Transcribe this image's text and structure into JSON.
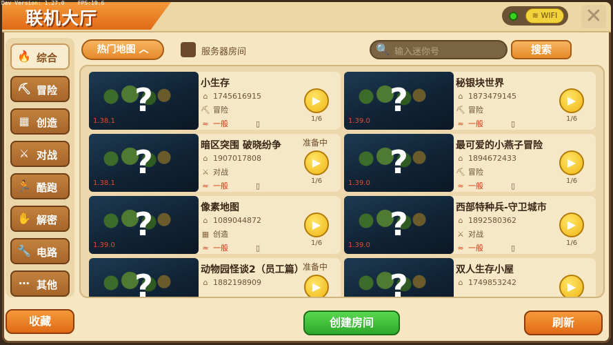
{
  "debug": {
    "version": "Dev Version: 1.27.0",
    "fps": "FPS:19.6"
  },
  "header": {
    "title": "联机大厅",
    "wifi_label": "WIFI",
    "close_symbol": "✕"
  },
  "sidebar": {
    "items": [
      {
        "label": "综合",
        "icon": "flame-icon",
        "glyph": "🔥",
        "active": true
      },
      {
        "label": "冒险",
        "icon": "pickaxe-icon",
        "glyph": "⛏"
      },
      {
        "label": "创造",
        "icon": "blocks-icon",
        "glyph": "▦"
      },
      {
        "label": "对战",
        "icon": "swords-icon",
        "glyph": "⚔"
      },
      {
        "label": "酷跑",
        "icon": "runner-icon",
        "glyph": "🏃"
      },
      {
        "label": "解密",
        "icon": "puzzle-icon",
        "glyph": "✋"
      },
      {
        "label": "电路",
        "icon": "wrench-icon",
        "glyph": "🔧"
      },
      {
        "label": "其他",
        "icon": "more-icon",
        "glyph": "⋯"
      }
    ]
  },
  "filters": {
    "hot_map_label": "热门地图",
    "hot_map_arrow": "︿",
    "server_room_label": "服务器房间",
    "search_placeholder": "输入迷你号",
    "search_button": "搜索"
  },
  "rooms": [
    {
      "name": "小生存",
      "id": "1745616915",
      "mode": "冒险",
      "mode_glyph": "⛏",
      "signal": "一般",
      "players": "1/6",
      "version": "1.38.1",
      "status": ""
    },
    {
      "name": "秘银块世界",
      "id": "1873479145",
      "mode": "冒险",
      "mode_glyph": "⛏",
      "signal": "一般",
      "players": "1/6",
      "version": "1.39.0",
      "status": ""
    },
    {
      "name": "暗区突围 破晓纷争",
      "id": "1907017808",
      "mode": "对战",
      "mode_glyph": "⚔",
      "signal": "一般",
      "players": "1/6",
      "version": "1.38.1",
      "status": "准备中"
    },
    {
      "name": "最可爱的小燕子冒险",
      "id": "1894672433",
      "mode": "冒险",
      "mode_glyph": "⛏",
      "signal": "一般",
      "players": "1/6",
      "version": "1.39.0",
      "status": ""
    },
    {
      "name": "像素地图",
      "id": "1089044872",
      "mode": "创造",
      "mode_glyph": "▦",
      "signal": "一般",
      "players": "1/6",
      "version": "1.39.0",
      "status": ""
    },
    {
      "name": "西部特种兵-守卫城市",
      "id": "1892580362",
      "mode": "对战",
      "mode_glyph": "⚔",
      "signal": "一般",
      "players": "1/6",
      "version": "1.39.0",
      "status": ""
    },
    {
      "name": "动物园怪谈2（员工篇）",
      "id": "1882198909",
      "mode": "",
      "mode_glyph": "",
      "signal": "",
      "players": "",
      "version": "",
      "status": "准备中"
    },
    {
      "name": "双人生存小屋",
      "id": "1749853242",
      "mode": "",
      "mode_glyph": "",
      "signal": "",
      "players": "",
      "version": "",
      "status": ""
    }
  ],
  "footer": {
    "favorites": "收藏",
    "create_room": "创建房间",
    "refresh": "刷新"
  },
  "colors": {
    "accent_orange": "#e06a16",
    "create_green": "#2ea82a",
    "panel": "#f6e7c2",
    "signal_red": "#d13a14"
  }
}
